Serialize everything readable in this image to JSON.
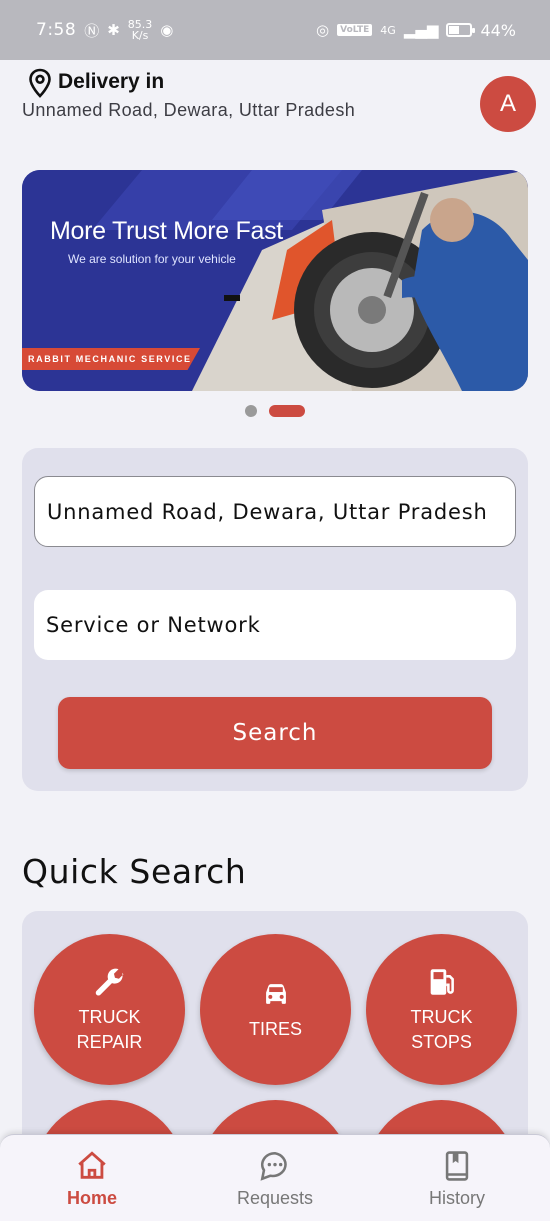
{
  "status_bar": {
    "time": "7:58",
    "speed_value": "85.3",
    "speed_unit": "K/s",
    "volte": "VoLTE",
    "network": "4G",
    "battery": "44%",
    "battery_level": 0.44
  },
  "header": {
    "delivery_label": "Delivery in",
    "address": "Unnamed Road, Dewara, Uttar Pradesh",
    "avatar_initial": "A"
  },
  "banner": {
    "title": "More Trust More Fast",
    "subtitle": "We are solution for your vehicle",
    "tag": "RABBIT MECHANIC SERVICE",
    "slide_count": 2,
    "active_slide": 2
  },
  "search": {
    "location_value": "Unnamed Road, Dewara, Uttar Pradesh",
    "service_placeholder": "Service or Network",
    "button_label": "Search"
  },
  "quick_search": {
    "title": "Quick Search",
    "items": [
      {
        "label": "TRUCK\nREPAIR",
        "icon": "wrench-icon"
      },
      {
        "label": "TIRES",
        "icon": "car-icon"
      },
      {
        "label": "TRUCK\nSTOPS",
        "icon": "fuel-pump-icon"
      },
      {
        "label": "",
        "icon": "partially-hidden"
      },
      {
        "label": "",
        "icon": "partially-hidden"
      },
      {
        "label": "",
        "icon": "partially-hidden"
      }
    ]
  },
  "nav": {
    "items": [
      {
        "label": "Home",
        "icon": "home-icon",
        "active": true
      },
      {
        "label": "Requests",
        "icon": "chat-bubble-icon",
        "active": false
      },
      {
        "label": "History",
        "icon": "book-icon",
        "active": false
      }
    ]
  },
  "colors": {
    "accent": "#cc4b41",
    "card_bg": "#e0e0ec",
    "page_bg": "#f2f2f7"
  }
}
